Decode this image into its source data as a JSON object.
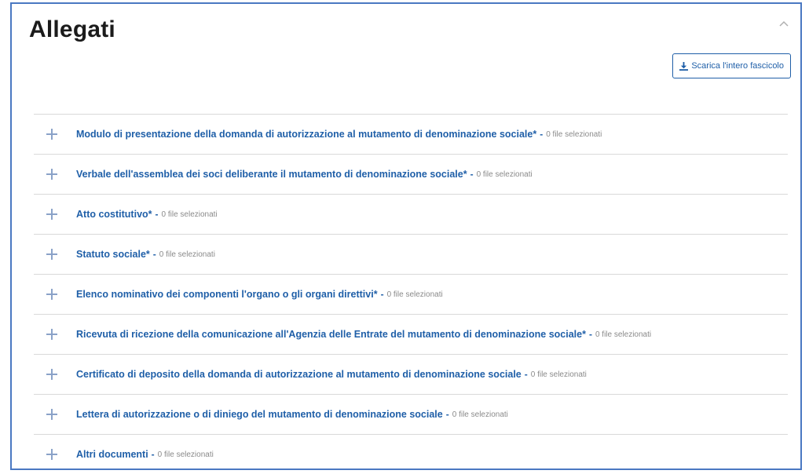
{
  "section": {
    "title": "Allegati",
    "download_label": "Scarica l'intero fascicolo",
    "collapse_icon": "chevron-up-icon",
    "download_icon": "download-icon"
  },
  "attachments": [
    {
      "label": "Modulo di presentazione della domanda di autorizzazione al mutamento di denominazione sociale*",
      "separator": "-",
      "count": "0 file selezionati"
    },
    {
      "label": "Verbale dell'assemblea dei soci deliberante il mutamento di denominazione sociale*",
      "separator": "-",
      "count": "0 file selezionati"
    },
    {
      "label": "Atto costitutivo*",
      "separator": "-",
      "count": "0 file selezionati"
    },
    {
      "label": "Statuto sociale*",
      "separator": "-",
      "count": "0 file selezionati"
    },
    {
      "label": "Elenco nominativo dei componenti l'organo o gli organi direttivi*",
      "separator": "-",
      "count": "0 file selezionati"
    },
    {
      "label": "Ricevuta di ricezione della comunicazione all'Agenzia delle Entrate del mutamento di denominazione sociale*",
      "separator": "-",
      "count": "0 file selezionati"
    },
    {
      "label": "Certificato di deposito della domanda di autorizzazione al mutamento di denominazione sociale",
      "separator": "-",
      "count": "0 file selezionati"
    },
    {
      "label": "Lettera di autorizzazione o di diniego del mutamento di denominazione sociale",
      "separator": "-",
      "count": "0 file selezionati"
    },
    {
      "label": "Altri documenti",
      "separator": "-",
      "count": "0 file selezionati"
    }
  ],
  "colors": {
    "accent": "#1f5fa8",
    "border": "#4a78c2",
    "muted": "#8a8a8a"
  }
}
